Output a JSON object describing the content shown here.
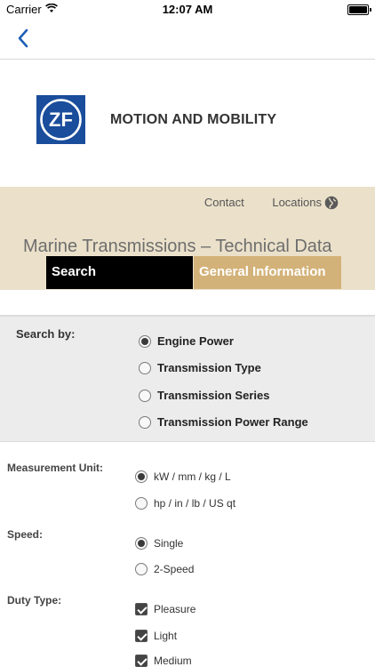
{
  "status_bar": {
    "carrier": "Carrier",
    "time": "12:07 AM"
  },
  "brand": {
    "logo_text": "ZF",
    "title": "MOTION AND MOBILITY"
  },
  "header_links": {
    "contact": "Contact",
    "locations": "Locations"
  },
  "page_title": "Marine Transmissions – Technical Data",
  "tabs": {
    "search": "Search",
    "general_info": "General Information"
  },
  "search_by": {
    "label": "Search by:",
    "options": [
      {
        "label": "Engine Power",
        "selected": true
      },
      {
        "label": "Transmission Type",
        "selected": false
      },
      {
        "label": "Transmission Series",
        "selected": false
      },
      {
        "label": "Transmission Power Range",
        "selected": false
      }
    ]
  },
  "measurement_unit": {
    "label": "Measurement Unit:",
    "options": [
      {
        "label": "kW / mm / kg / L",
        "selected": true
      },
      {
        "label": "hp / in / lb / US qt",
        "selected": false
      }
    ]
  },
  "speed": {
    "label": "Speed:",
    "options": [
      {
        "label": "Single",
        "selected": true
      },
      {
        "label": "2-Speed",
        "selected": false
      }
    ]
  },
  "duty_type": {
    "label": "Duty Type:",
    "options": [
      {
        "label": "Pleasure",
        "checked": true
      },
      {
        "label": "Light",
        "checked": true
      },
      {
        "label": "Medium",
        "checked": true
      }
    ]
  },
  "colors": {
    "accent_blue": "#1a4d9b",
    "band": "#ebe1ca",
    "tab_gold": "#d3b279",
    "nav_blue": "#1f5fb5"
  }
}
